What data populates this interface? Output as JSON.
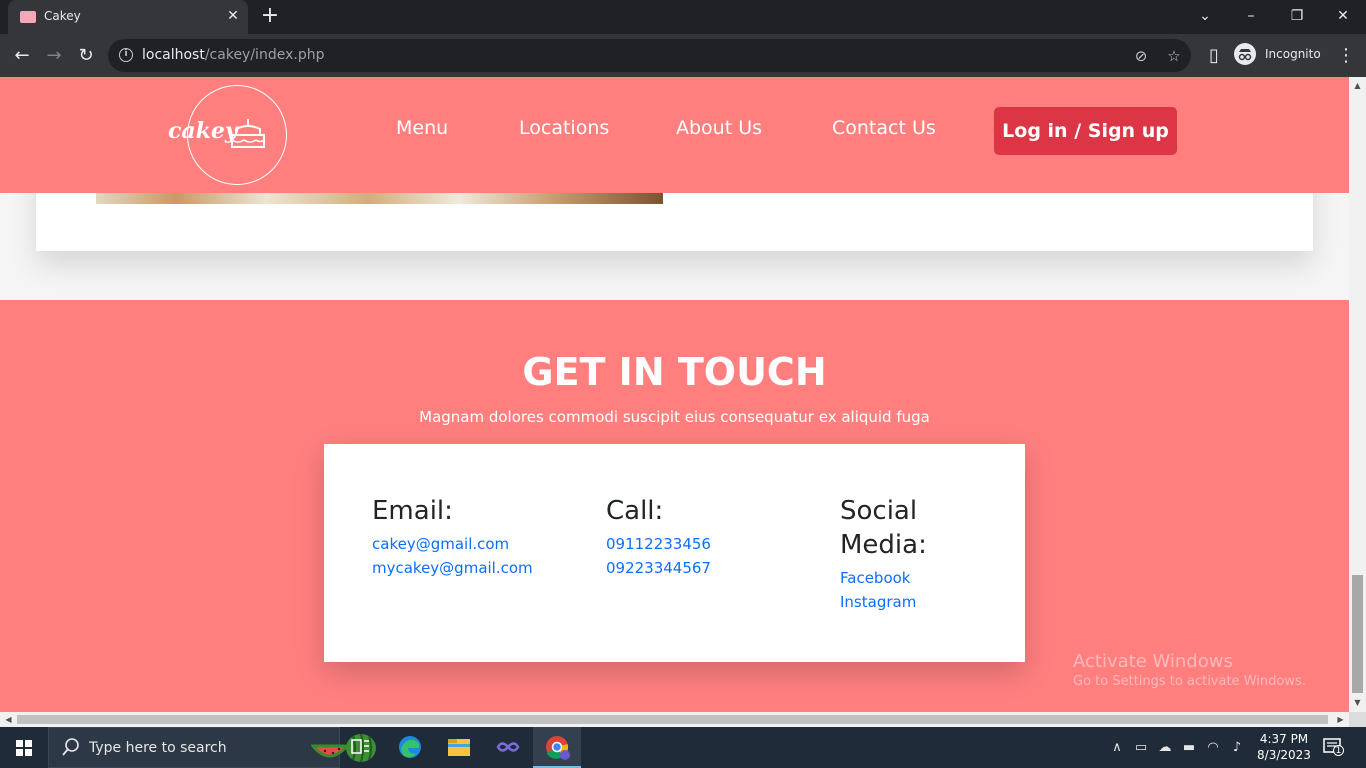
{
  "browser": {
    "tab_title": "Cakey",
    "url_host": "localhost",
    "url_path": "/cakey/index.php",
    "profile_label": "Incognito"
  },
  "site": {
    "logo_text": "cakey",
    "nav": [
      "Menu",
      "Locations",
      "About Us",
      "Contact Us"
    ],
    "login_label": "Log in / Sign up"
  },
  "contact": {
    "title": "GET IN TOUCH",
    "subtitle": "Magnam dolores commodi suscipit eius consequatur ex aliquid fuga",
    "email_title": "Email:",
    "emails": [
      "cakey@gmail.com",
      "mycakey@gmail.com"
    ],
    "call_title": "Call:",
    "phones": [
      "09112233456",
      "09223344567"
    ],
    "social_title_1": "Social",
    "social_title_2": "Media:",
    "socials": [
      "Facebook",
      "Instagram"
    ]
  },
  "watermark": {
    "title": "Activate Windows",
    "subtitle": "Go to Settings to activate Windows."
  },
  "taskbar": {
    "search_placeholder": "Type here to search",
    "time": "4:37 PM",
    "date": "8/3/2023",
    "notification_count": "1"
  },
  "colors": {
    "brand_pink": "#ff7f7f",
    "login_red": "#dc3545",
    "link_blue": "#0d6efd"
  }
}
